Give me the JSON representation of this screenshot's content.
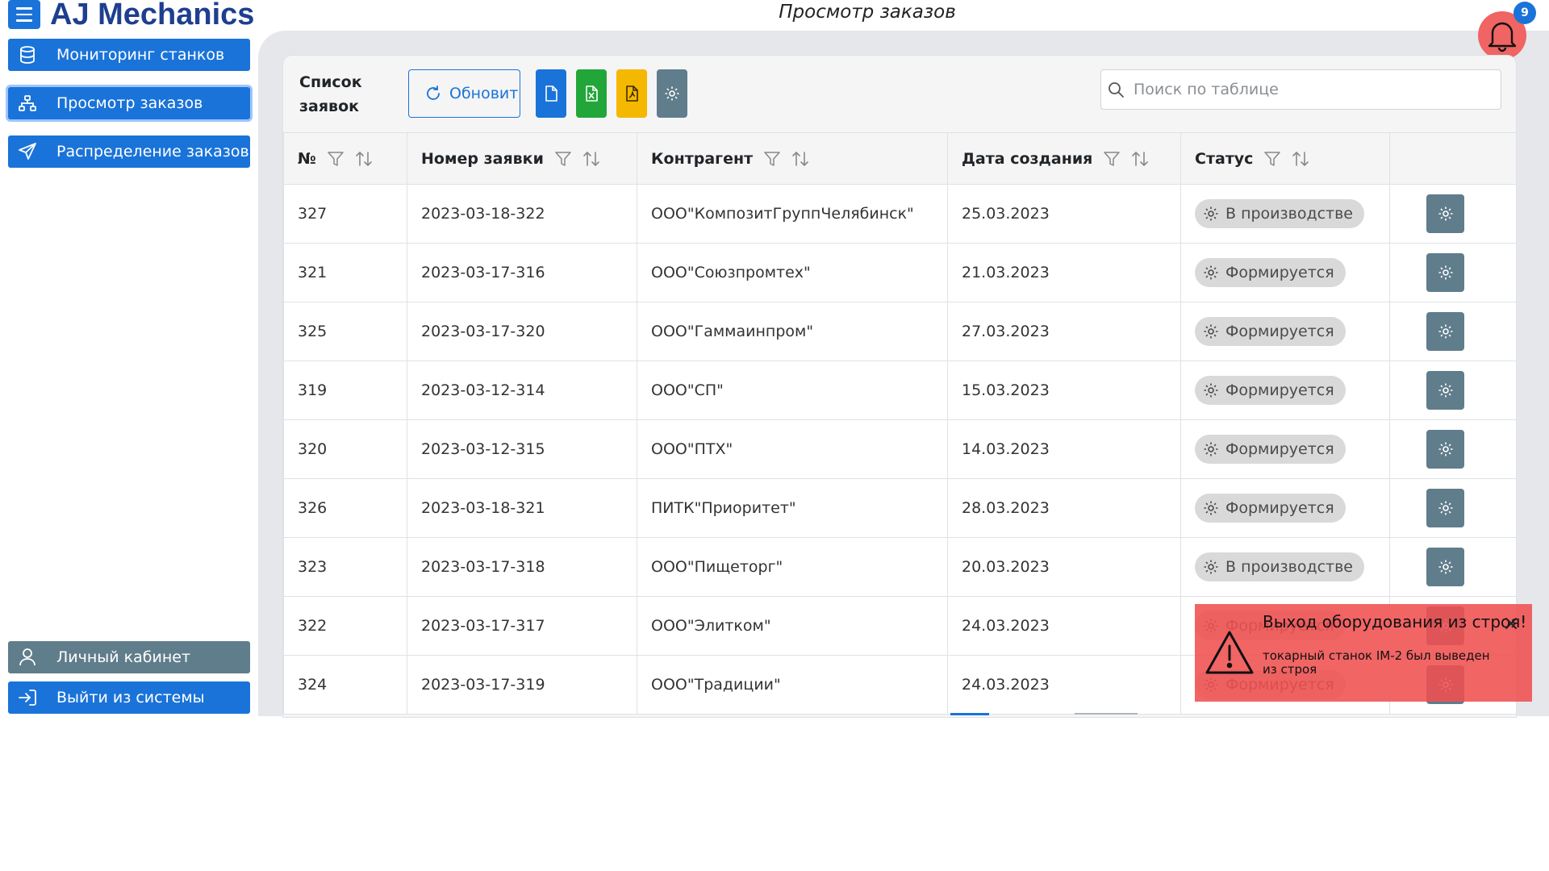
{
  "app": {
    "brand": "AJ Mechanics",
    "page_title": "Просмотр заказов",
    "notification_count": "9"
  },
  "sidebar": {
    "items": [
      {
        "label": "Мониторинг станков",
        "icon": "database-icon"
      },
      {
        "label": "Просмотр заказов",
        "icon": "sitemap-icon",
        "active": true
      },
      {
        "label": "Распределение заказов",
        "icon": "send-icon"
      }
    ],
    "bottom_items": [
      {
        "label": "Личный кабинет",
        "icon": "user-icon"
      },
      {
        "label": "Выйти из системы",
        "icon": "sign-in-icon"
      }
    ]
  },
  "toolbar": {
    "title": "Список заявок",
    "refresh_label": "Обновить",
    "search_placeholder": "Поиск по таблице",
    "export_buttons": [
      {
        "icon": "file-icon",
        "color": "#1a73d9"
      },
      {
        "icon": "file-excel-icon",
        "color": "#22a63a"
      },
      {
        "icon": "file-pdf-icon",
        "color": "#f5b800"
      },
      {
        "icon": "gear-icon",
        "color": "#607d8b"
      }
    ]
  },
  "table": {
    "columns": [
      "№",
      "Номер заявки",
      "Контрагент",
      "Дата создания",
      "Статус"
    ],
    "rows": [
      {
        "id": "327",
        "number": "2023-03-18-322",
        "contractor": "ООО\"КомпозитГруппЧелябинск\"",
        "date": "25.03.2023",
        "status": "В производстве"
      },
      {
        "id": "321",
        "number": "2023-03-17-316",
        "contractor": "ООО\"Союзпромтех\"",
        "date": "21.03.2023",
        "status": "Формируется"
      },
      {
        "id": "325",
        "number": "2023-03-17-320",
        "contractor": "ООО\"Гаммаинпром\"",
        "date": "27.03.2023",
        "status": "Формируется"
      },
      {
        "id": "319",
        "number": "2023-03-12-314",
        "contractor": "ООО\"СП\"",
        "date": "15.03.2023",
        "status": "Формируется"
      },
      {
        "id": "320",
        "number": "2023-03-12-315",
        "contractor": "ООО\"ПТХ\"",
        "date": "14.03.2023",
        "status": "Формируется"
      },
      {
        "id": "326",
        "number": "2023-03-18-321",
        "contractor": "ПИТК\"Приоритет\"",
        "date": "28.03.2023",
        "status": "Формируется"
      },
      {
        "id": "323",
        "number": "2023-03-17-318",
        "contractor": "ООО\"Пищеторг\"",
        "date": "20.03.2023",
        "status": "В производстве"
      },
      {
        "id": "322",
        "number": "2023-03-17-317",
        "contractor": "ООО\"Элитком\"",
        "date": "24.03.2023",
        "status": "Формируется"
      },
      {
        "id": "324",
        "number": "2023-03-17-319",
        "contractor": "ООО\"Традиции\"",
        "date": "24.03.2023",
        "status": "Формируется"
      }
    ]
  },
  "toast": {
    "title": "Выход оборудования из строя!",
    "message": "токарный станок IM-2 был выведен из строя",
    "color": "#f05050"
  }
}
